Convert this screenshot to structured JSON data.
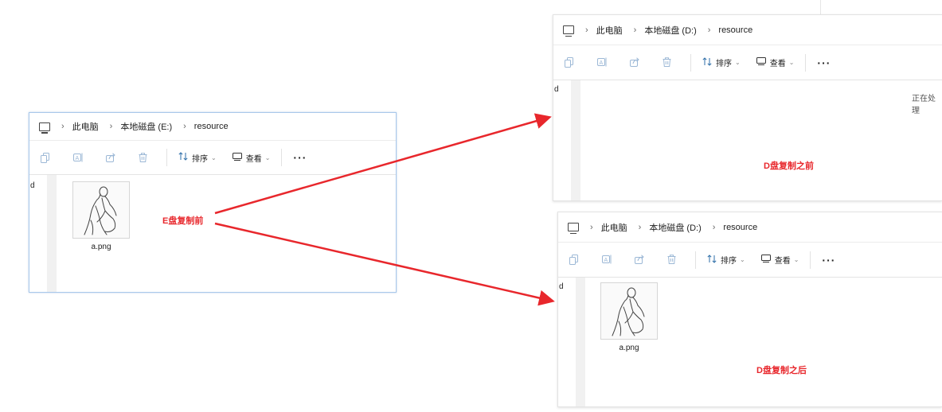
{
  "windows": {
    "e_drive": {
      "breadcrumb": [
        "此电脑",
        "本地磁盘 (E:)",
        "resource"
      ],
      "nav_letter": "d",
      "file": {
        "name": "a.png",
        "icon": "sketch-image"
      }
    },
    "d_drive_before": {
      "breadcrumb": [
        "此电脑",
        "本地磁盘 (D:)",
        "resource"
      ],
      "nav_letter": "d",
      "status": "正在处理"
    },
    "d_drive_after": {
      "breadcrumb": [
        "此电脑",
        "本地磁盘 (D:)",
        "resource"
      ],
      "nav_letter": "d",
      "file": {
        "name": "a.png",
        "icon": "sketch-image"
      }
    }
  },
  "toolbar": {
    "sort_label": "排序",
    "view_label": "查看",
    "more_label": "···",
    "icons": [
      "copy-icon",
      "rename-icon",
      "share-icon",
      "delete-icon",
      "sort-icon",
      "view-icon"
    ]
  },
  "annotations": {
    "e_before": "E盘复制前",
    "d_before": "D盘复制之前",
    "d_after": "D盘复制之后",
    "color": "#e8272c"
  }
}
